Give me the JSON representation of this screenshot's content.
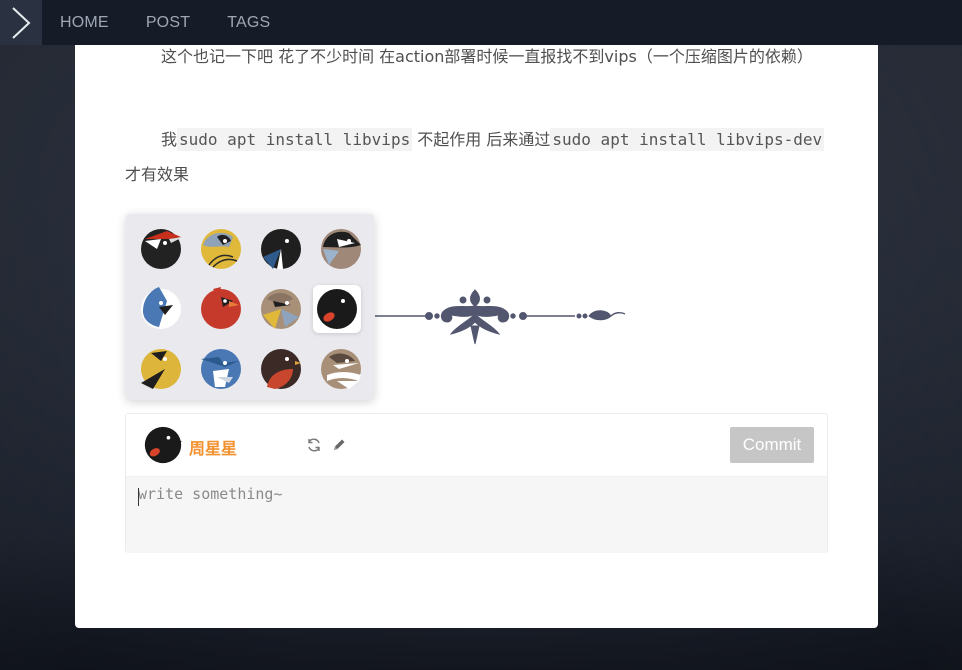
{
  "nav": {
    "toggle_icon": "chevron-right-icon",
    "links": [
      "HOME",
      "POST",
      "TAGS"
    ]
  },
  "article": {
    "para1": "这个也记一下吧 花了不少时间 在action部署时候一直报找不到vips（一个压缩图片的依赖）",
    "para2_prefix": "我",
    "para2_code1": "sudo apt install libvips",
    "para2_mid": " 不起作用 后来通过",
    "para2_code2": "sudo apt install libvips-dev",
    "para2_suffix": "才有效果"
  },
  "avatar_picker": {
    "items": [
      {
        "name": "woodpecker-bird-icon",
        "selected": false
      },
      {
        "name": "goldfinch-bird-icon",
        "selected": false
      },
      {
        "name": "black-bird-icon",
        "selected": false
      },
      {
        "name": "tit-bird-icon",
        "selected": false
      },
      {
        "name": "bluejay-bird-icon",
        "selected": false
      },
      {
        "name": "cardinal-bird-icon",
        "selected": false
      },
      {
        "name": "waxwing-bird-icon",
        "selected": false
      },
      {
        "name": "blackbird-red-beak-icon",
        "selected": true
      },
      {
        "name": "yellow-bird-icon",
        "selected": false
      },
      {
        "name": "kingfisher-bird-icon",
        "selected": false
      },
      {
        "name": "robin-bird-icon",
        "selected": false
      },
      {
        "name": "sparrow-bird-icon",
        "selected": false
      }
    ]
  },
  "comment": {
    "username": "周星星",
    "refresh_icon": "refresh-icon",
    "edit_icon": "pencil-icon",
    "commit_label": "Commit",
    "placeholder": "write something~"
  },
  "colors": {
    "nav_bg": "#151b27",
    "username": "#f2912e",
    "commit_disabled": "#c6c6c6"
  }
}
